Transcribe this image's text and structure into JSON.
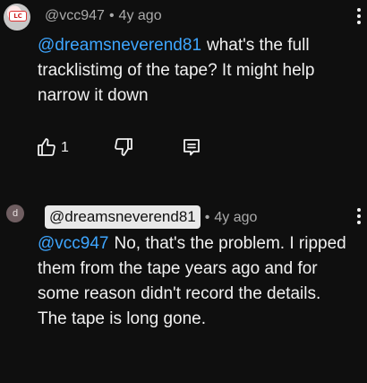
{
  "comments": [
    {
      "avatar_letter": "",
      "avatar_mark": "LC",
      "author": "@vcc947",
      "separator": "•",
      "time": "4y ago",
      "mention": "@dreamsneverend81",
      "text": "what's the full tracklistimg of the tape? It might help narrow it down",
      "likes": "1"
    },
    {
      "avatar_letter": "d",
      "author": "@dreamsneverend81",
      "separator": "•",
      "time": "4y ago",
      "mention": "@vcc947",
      "text": "No, that's the problem. I ripped them from the tape years ago and for some reason didn't record the details. The tape is long gone."
    }
  ],
  "icons": {
    "like": "thumbs-up-icon",
    "dislike": "thumbs-down-icon",
    "reply": "reply-comment-icon",
    "more": "more-vertical-icon"
  }
}
